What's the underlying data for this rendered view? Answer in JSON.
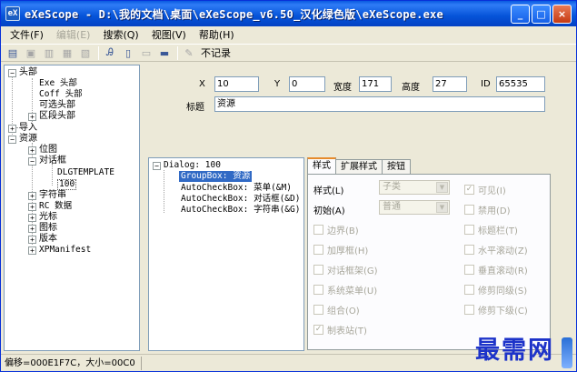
{
  "window": {
    "title": "eXeScope - D:\\我的文档\\桌面\\eXeScope_v6.50_汉化绿色版\\eXeScope.exe",
    "icon_label": "eX"
  },
  "window_buttons": [
    "_",
    "□",
    "×"
  ],
  "menu": [
    {
      "label": "文件(F)",
      "enabled": true
    },
    {
      "label": "编辑(E)",
      "enabled": false
    },
    {
      "label": "搜索(Q)",
      "enabled": true
    },
    {
      "label": "视图(V)",
      "enabled": true
    },
    {
      "label": "帮助(H)",
      "enabled": true
    }
  ],
  "toolbar": {
    "norecord_label": "不记录"
  },
  "tree": {
    "header": "头部",
    "exe_header": "Exe 头部",
    "coff_header": "Coff 头部",
    "optional_header": "可选头部",
    "section_header": "区段头部",
    "import": "导入",
    "resource": "资源",
    "bitmap": "位图",
    "dialog": "对话框",
    "dlgtemplate": "DLGTEMPLATE",
    "dlg_100": "100",
    "string": "字符串",
    "rc_data": "RC 数据",
    "cursor": "光标",
    "icon": "图标",
    "version": "版本",
    "xpmanifest": "XPManifest"
  },
  "props": {
    "x_label": "X",
    "x_value": "10",
    "y_label": "Y",
    "y_value": "0",
    "width_label": "宽度",
    "width_value": "171",
    "height_label": "高度",
    "height_value": "27",
    "id_label": "ID",
    "id_value": "65535",
    "caption_label": "标题",
    "caption_value": "资源"
  },
  "dialog_tree": {
    "root": "Dialog: 100",
    "items": [
      "GroupBox: 资源",
      "AutoCheckBox: 菜单(&M)",
      "AutoCheckBox: 对话框(&D)",
      "AutoCheckBox: 字符串(&G)"
    ]
  },
  "tabs": [
    "样式",
    "扩展样式",
    "按钮"
  ],
  "style_panel": {
    "style_label": "样式(L)",
    "style_value": "子类",
    "init_label": "初始(A)",
    "init_value": "普通",
    "checks": [
      {
        "label": "可见(I)",
        "checked": true
      },
      {
        "label": "禁用(D)",
        "checked": false
      },
      {
        "label": "边界(B)",
        "checked": false
      },
      {
        "label": "标题栏(T)",
        "checked": false
      },
      {
        "label": "加厚框(H)",
        "checked": false
      },
      {
        "label": "水平滚动(Z)",
        "checked": false
      },
      {
        "label": "对话框架(G)",
        "checked": false
      },
      {
        "label": "垂直滚动(R)",
        "checked": false
      },
      {
        "label": "系统菜单(U)",
        "checked": false
      },
      {
        "label": "修剪同级(S)",
        "checked": false
      },
      {
        "label": "组合(O)",
        "checked": false
      },
      {
        "label": "修剪下级(C)",
        "checked": false
      },
      {
        "label": "制表站(T)",
        "checked": true
      }
    ]
  },
  "status": {
    "offset": "偏移=000E1F7C，大小=00C0"
  },
  "watermark": "最需网"
}
